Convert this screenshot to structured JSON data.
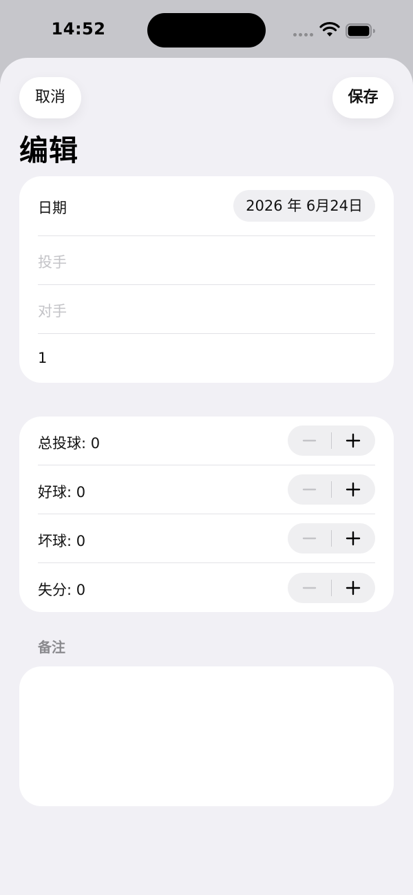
{
  "status_bar": {
    "time": "14:52",
    "icons": [
      "signal-icon",
      "wifi-icon",
      "battery-icon"
    ]
  },
  "nav": {
    "cancel_label": "取消",
    "save_label": "保存",
    "title": "编辑"
  },
  "form": {
    "date_label": "日期",
    "date_value": "2026 年 6月24日",
    "pitcher_placeholder": "投手",
    "opponent_placeholder": "对手",
    "number_value": "1"
  },
  "counters": [
    {
      "label": "总投球: 0",
      "minus_icon": "minus-icon",
      "plus_icon": "plus-icon"
    },
    {
      "label": "好球: 0",
      "minus_icon": "minus-icon",
      "plus_icon": "plus-icon"
    },
    {
      "label": "坏球: 0",
      "minus_icon": "minus-icon",
      "plus_icon": "plus-icon"
    },
    {
      "label": "失分: 0",
      "minus_icon": "minus-icon",
      "plus_icon": "plus-icon"
    }
  ],
  "notes": {
    "label": "备注",
    "value": ""
  },
  "colors": {
    "sheet_background": "#f1f0f5",
    "card_background": "#ffffff",
    "placeholder_text": "#c3c3c7",
    "disabled_minus": "#c4c4c8",
    "section_header": "#8a8a8e"
  }
}
